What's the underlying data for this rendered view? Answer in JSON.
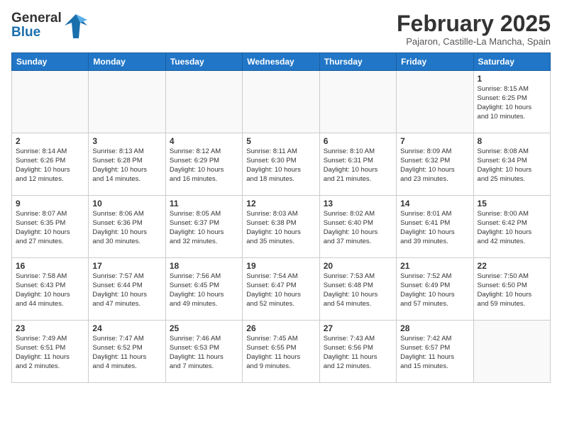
{
  "logo": {
    "line1": "General",
    "line2": "Blue"
  },
  "title": "February 2025",
  "location": "Pajaron, Castille-La Mancha, Spain",
  "days_of_week": [
    "Sunday",
    "Monday",
    "Tuesday",
    "Wednesday",
    "Thursday",
    "Friday",
    "Saturday"
  ],
  "weeks": [
    [
      {
        "day": "",
        "info": ""
      },
      {
        "day": "",
        "info": ""
      },
      {
        "day": "",
        "info": ""
      },
      {
        "day": "",
        "info": ""
      },
      {
        "day": "",
        "info": ""
      },
      {
        "day": "",
        "info": ""
      },
      {
        "day": "1",
        "info": "Sunrise: 8:15 AM\nSunset: 6:25 PM\nDaylight: 10 hours\nand 10 minutes."
      }
    ],
    [
      {
        "day": "2",
        "info": "Sunrise: 8:14 AM\nSunset: 6:26 PM\nDaylight: 10 hours\nand 12 minutes."
      },
      {
        "day": "3",
        "info": "Sunrise: 8:13 AM\nSunset: 6:28 PM\nDaylight: 10 hours\nand 14 minutes."
      },
      {
        "day": "4",
        "info": "Sunrise: 8:12 AM\nSunset: 6:29 PM\nDaylight: 10 hours\nand 16 minutes."
      },
      {
        "day": "5",
        "info": "Sunrise: 8:11 AM\nSunset: 6:30 PM\nDaylight: 10 hours\nand 18 minutes."
      },
      {
        "day": "6",
        "info": "Sunrise: 8:10 AM\nSunset: 6:31 PM\nDaylight: 10 hours\nand 21 minutes."
      },
      {
        "day": "7",
        "info": "Sunrise: 8:09 AM\nSunset: 6:32 PM\nDaylight: 10 hours\nand 23 minutes."
      },
      {
        "day": "8",
        "info": "Sunrise: 8:08 AM\nSunset: 6:34 PM\nDaylight: 10 hours\nand 25 minutes."
      }
    ],
    [
      {
        "day": "9",
        "info": "Sunrise: 8:07 AM\nSunset: 6:35 PM\nDaylight: 10 hours\nand 27 minutes."
      },
      {
        "day": "10",
        "info": "Sunrise: 8:06 AM\nSunset: 6:36 PM\nDaylight: 10 hours\nand 30 minutes."
      },
      {
        "day": "11",
        "info": "Sunrise: 8:05 AM\nSunset: 6:37 PM\nDaylight: 10 hours\nand 32 minutes."
      },
      {
        "day": "12",
        "info": "Sunrise: 8:03 AM\nSunset: 6:38 PM\nDaylight: 10 hours\nand 35 minutes."
      },
      {
        "day": "13",
        "info": "Sunrise: 8:02 AM\nSunset: 6:40 PM\nDaylight: 10 hours\nand 37 minutes."
      },
      {
        "day": "14",
        "info": "Sunrise: 8:01 AM\nSunset: 6:41 PM\nDaylight: 10 hours\nand 39 minutes."
      },
      {
        "day": "15",
        "info": "Sunrise: 8:00 AM\nSunset: 6:42 PM\nDaylight: 10 hours\nand 42 minutes."
      }
    ],
    [
      {
        "day": "16",
        "info": "Sunrise: 7:58 AM\nSunset: 6:43 PM\nDaylight: 10 hours\nand 44 minutes."
      },
      {
        "day": "17",
        "info": "Sunrise: 7:57 AM\nSunset: 6:44 PM\nDaylight: 10 hours\nand 47 minutes."
      },
      {
        "day": "18",
        "info": "Sunrise: 7:56 AM\nSunset: 6:45 PM\nDaylight: 10 hours\nand 49 minutes."
      },
      {
        "day": "19",
        "info": "Sunrise: 7:54 AM\nSunset: 6:47 PM\nDaylight: 10 hours\nand 52 minutes."
      },
      {
        "day": "20",
        "info": "Sunrise: 7:53 AM\nSunset: 6:48 PM\nDaylight: 10 hours\nand 54 minutes."
      },
      {
        "day": "21",
        "info": "Sunrise: 7:52 AM\nSunset: 6:49 PM\nDaylight: 10 hours\nand 57 minutes."
      },
      {
        "day": "22",
        "info": "Sunrise: 7:50 AM\nSunset: 6:50 PM\nDaylight: 10 hours\nand 59 minutes."
      }
    ],
    [
      {
        "day": "23",
        "info": "Sunrise: 7:49 AM\nSunset: 6:51 PM\nDaylight: 11 hours\nand 2 minutes."
      },
      {
        "day": "24",
        "info": "Sunrise: 7:47 AM\nSunset: 6:52 PM\nDaylight: 11 hours\nand 4 minutes."
      },
      {
        "day": "25",
        "info": "Sunrise: 7:46 AM\nSunset: 6:53 PM\nDaylight: 11 hours\nand 7 minutes."
      },
      {
        "day": "26",
        "info": "Sunrise: 7:45 AM\nSunset: 6:55 PM\nDaylight: 11 hours\nand 9 minutes."
      },
      {
        "day": "27",
        "info": "Sunrise: 7:43 AM\nSunset: 6:56 PM\nDaylight: 11 hours\nand 12 minutes."
      },
      {
        "day": "28",
        "info": "Sunrise: 7:42 AM\nSunset: 6:57 PM\nDaylight: 11 hours\nand 15 minutes."
      },
      {
        "day": "",
        "info": ""
      }
    ]
  ]
}
